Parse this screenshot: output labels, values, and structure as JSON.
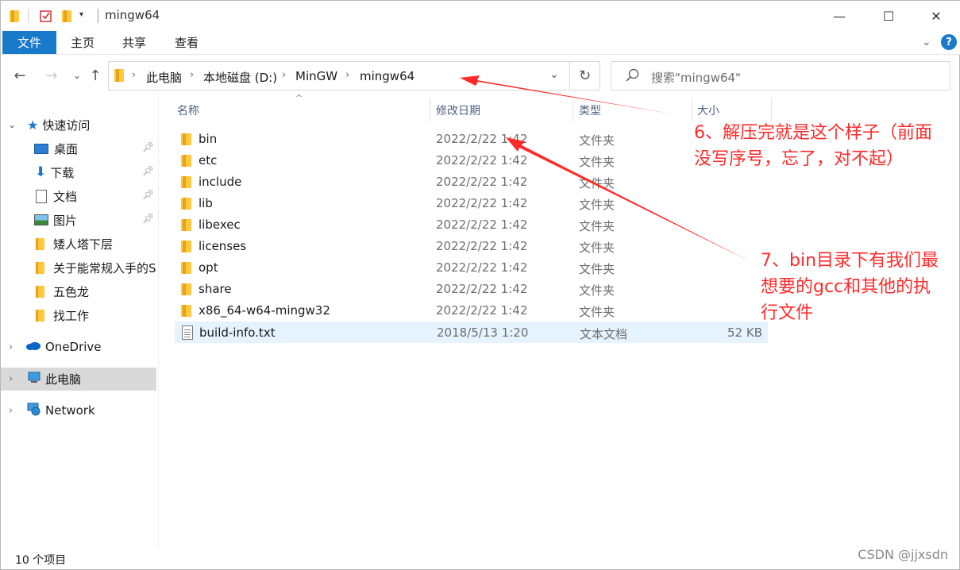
{
  "window": {
    "title": "mingw64",
    "controls": {
      "minimize": "—",
      "maximize": "☐",
      "close": "✕"
    }
  },
  "ribbon": {
    "tabs": [
      "文件",
      "主页",
      "共享",
      "查看"
    ],
    "help": "?"
  },
  "address": {
    "crumbs": [
      "此电脑",
      "本地磁盘 (D:)",
      "MinGW",
      "mingw64"
    ],
    "search_placeholder": "搜索\"mingw64\""
  },
  "sidebar": {
    "quick_access": "快速访问",
    "items": [
      "桌面",
      "下载",
      "文档",
      "图片",
      "矮人塔下层",
      "关于能常规入手的S",
      "五色龙",
      "找工作"
    ],
    "onedrive": "OneDrive",
    "this_pc": "此电脑",
    "network": "Network"
  },
  "columns": {
    "name": "名称",
    "date": "修改日期",
    "type": "类型",
    "size": "大小"
  },
  "files": [
    {
      "name": "bin",
      "date": "2022/2/22 1:42",
      "type": "文件夹",
      "size": "",
      "icon": "folder"
    },
    {
      "name": "etc",
      "date": "2022/2/22 1:42",
      "type": "文件夹",
      "size": "",
      "icon": "folder"
    },
    {
      "name": "include",
      "date": "2022/2/22 1:42",
      "type": "文件夹",
      "size": "",
      "icon": "folder"
    },
    {
      "name": "lib",
      "date": "2022/2/22 1:42",
      "type": "文件夹",
      "size": "",
      "icon": "folder"
    },
    {
      "name": "libexec",
      "date": "2022/2/22 1:42",
      "type": "文件夹",
      "size": "",
      "icon": "folder"
    },
    {
      "name": "licenses",
      "date": "2022/2/22 1:42",
      "type": "文件夹",
      "size": "",
      "icon": "folder"
    },
    {
      "name": "opt",
      "date": "2022/2/22 1:42",
      "type": "文件夹",
      "size": "",
      "icon": "folder"
    },
    {
      "name": "share",
      "date": "2022/2/22 1:42",
      "type": "文件夹",
      "size": "",
      "icon": "folder"
    },
    {
      "name": "x86_64-w64-mingw32",
      "date": "2022/2/22 1:42",
      "type": "文件夹",
      "size": "",
      "icon": "folder"
    },
    {
      "name": "build-info.txt",
      "date": "2018/5/13 1:20",
      "type": "文本文档",
      "size": "52 KB",
      "icon": "text-file"
    }
  ],
  "status": {
    "count": "10 个项目"
  },
  "annotations": {
    "note6_line1": "6、解压完就是这个样子（前面",
    "note6_line2": "没写序号，忘了，对不起）",
    "note7_line1": "7、bin目录下有我们最",
    "note7_line2": "想要的gcc和其他的执",
    "note7_line3": "行文件",
    "color": "#ff2b2b"
  },
  "watermark": "CSDN @jjxsdn"
}
